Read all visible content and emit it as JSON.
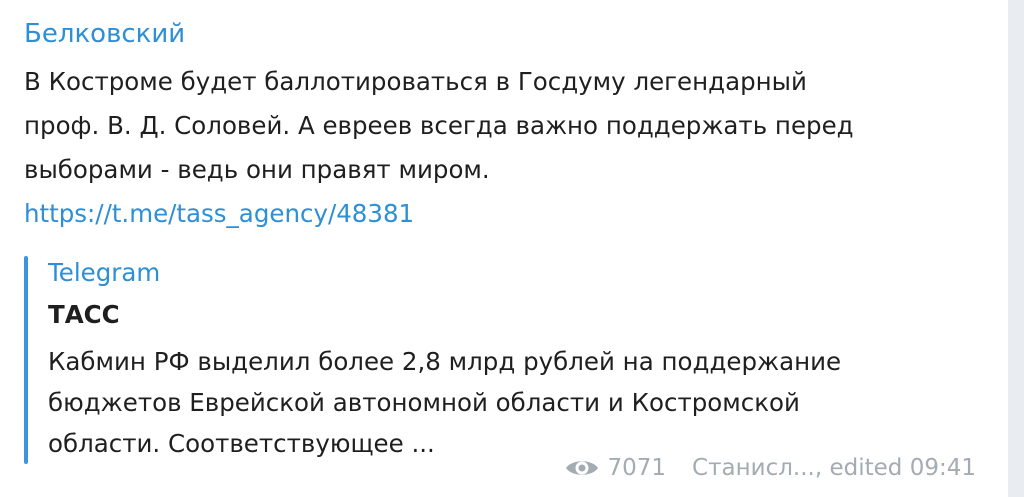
{
  "message": {
    "author": "Белковский",
    "text_lines": [
      "В Костроме будет баллотироваться в Госдуму легендарный",
      "проф. В. Д. Соловей. А евреев всегда важно поддержать перед",
      "выборами - ведь они правят миром."
    ],
    "link": "https://t.me/tass_agency/48381"
  },
  "preview": {
    "site": "Telegram",
    "title": "ТАСС",
    "description_lines": [
      "Кабмин РФ выделил более 2,8 млрд рублей на поддержание",
      "бюджетов Еврейской автономной области и Костромской",
      "области. Соответствующее ..."
    ]
  },
  "meta": {
    "icon": "eye-icon",
    "views": "7071",
    "signature": "Станисл..., edited 09:41"
  },
  "colors": {
    "accent": "#2e8fd6",
    "text": "#1f1f1f",
    "meta": "#a3abb3",
    "preview_bar": "#3a95de"
  }
}
